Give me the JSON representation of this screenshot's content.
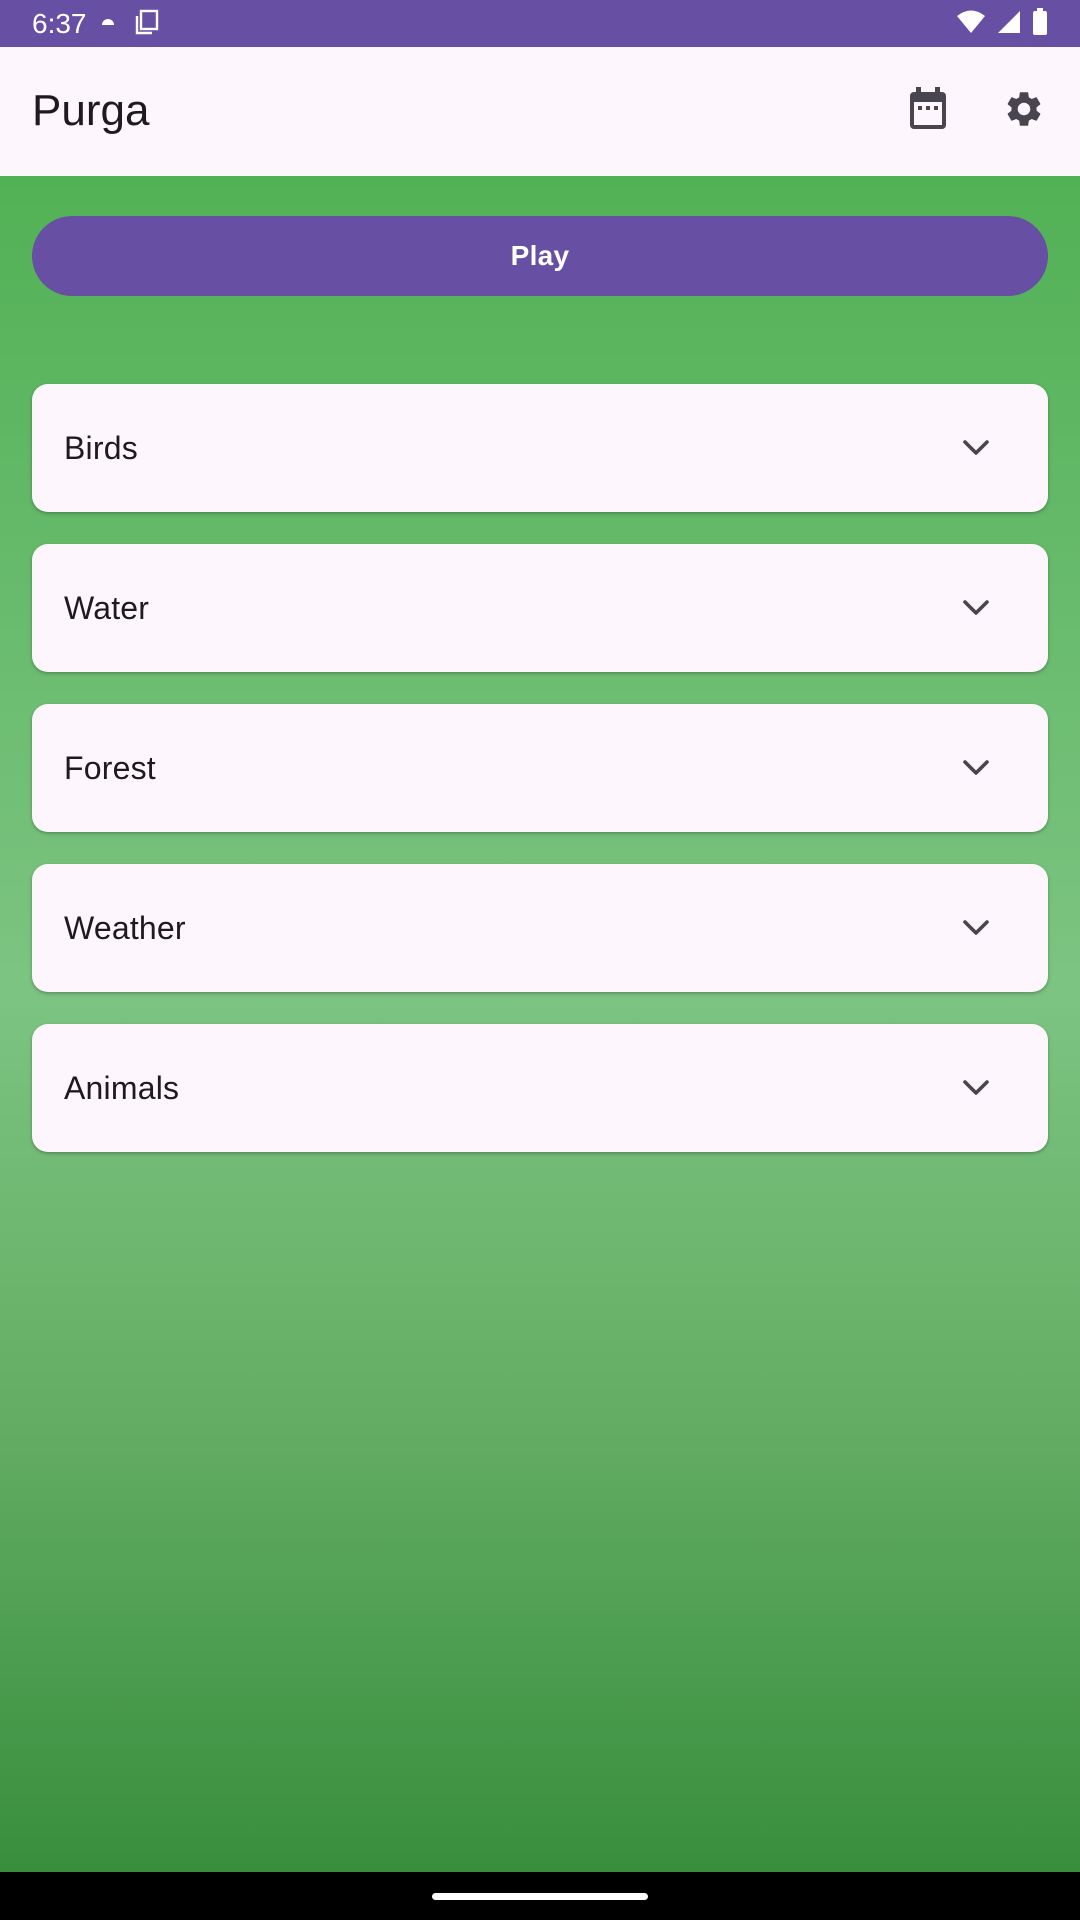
{
  "status_bar": {
    "time": "6:37",
    "background": "#6750a4",
    "left_icons": [
      "weather-icon",
      "screenshot-icon"
    ],
    "right_icons": [
      "wifi-icon",
      "signal-icon",
      "battery-icon"
    ]
  },
  "app_bar": {
    "title": "Purga",
    "actions": [
      {
        "name": "calendar-icon"
      },
      {
        "name": "settings-gear-icon"
      }
    ]
  },
  "main": {
    "play_label": "Play",
    "accent": "#6750a4",
    "categories": [
      {
        "label": "Birds"
      },
      {
        "label": "Water"
      },
      {
        "label": "Forest"
      },
      {
        "label": "Weather"
      },
      {
        "label": "Animals"
      }
    ]
  },
  "colors": {
    "background_top": "#52b155",
    "background_bottom": "#388e3c",
    "card": "#fdf7fd"
  }
}
